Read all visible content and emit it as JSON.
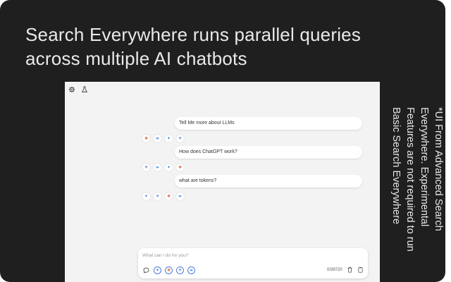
{
  "headline": " Search Everywhere runs parallel queries\nacross multiple AI chatbots",
  "side_note": "*UI From Advanced Search Everywhere. Experimental Features are not required to run Basic Search Everywhere",
  "colors": {
    "background": "#1f1f1f",
    "panel": "#f3f3f3",
    "accent": "#4b7bdc"
  },
  "toolbar": {
    "icons": [
      "settings-icon",
      "flask-icon"
    ]
  },
  "messages": [
    {
      "text": "Tell Me more about LLMs",
      "bots": [
        "claude-icon",
        "meta-ai-icon",
        "gemini-icon",
        "perplexity-icon"
      ]
    },
    {
      "text": "How does ChatGPT work?",
      "bots": [
        "perplexity-icon",
        "meta-ai-icon",
        "gemini-icon",
        "claude-icon"
      ]
    },
    {
      "text": "what are tokens?",
      "bots": [
        "gemini-icon",
        "perplexity-icon",
        "claude-icon",
        "meta-ai-icon"
      ]
    }
  ],
  "composer": {
    "placeholder": "What can I do for you?",
    "char_count": "0/39720",
    "tools": [
      "chat-icon",
      "gemini-icon",
      "claude-icon",
      "perplexity-icon",
      "meta-ai-icon"
    ],
    "actions": [
      "trash-icon",
      "clipboard-icon"
    ]
  }
}
